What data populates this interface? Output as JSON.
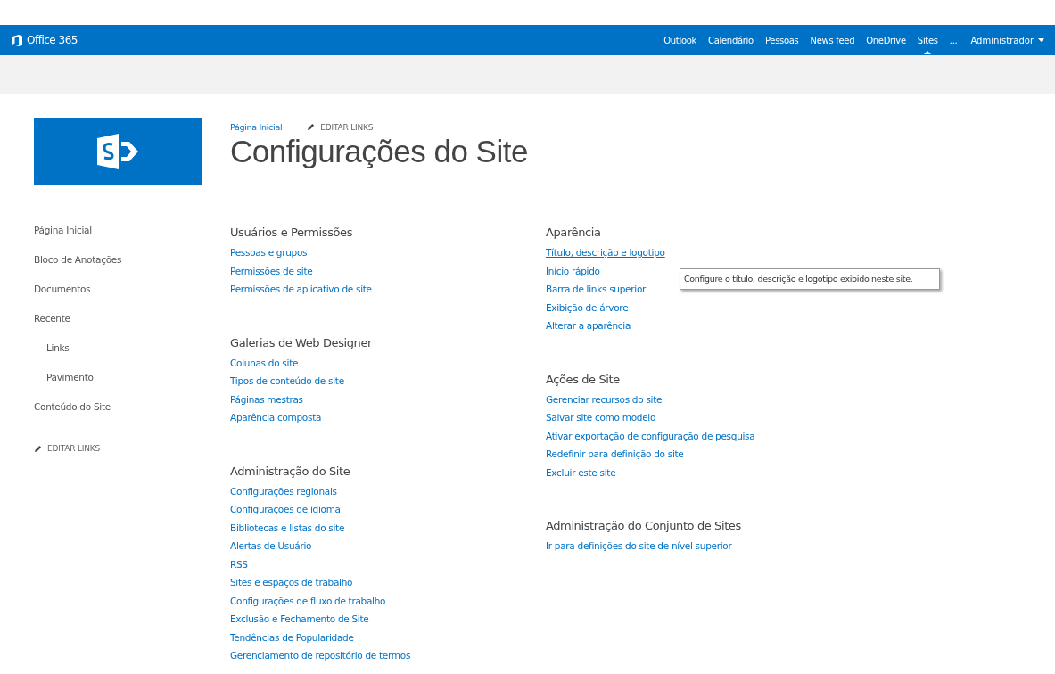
{
  "suite_bar": {
    "brand": "Office 365",
    "links": [
      {
        "label": "Outlook",
        "selected": false
      },
      {
        "label": "Calendário",
        "selected": false
      },
      {
        "label": "Pessoas",
        "selected": false
      },
      {
        "label": "News feed",
        "selected": false
      },
      {
        "label": "OneDrive",
        "selected": false
      },
      {
        "label": "Sites",
        "selected": true
      },
      {
        "label": "...",
        "selected": false
      }
    ],
    "user": "Administrador"
  },
  "breadcrumb": "Página Inicial",
  "edit_links_top": "EDITAR LINKS",
  "title": "Configurações do Site",
  "quick_launch": {
    "items": [
      {
        "label": "Página Inicial"
      },
      {
        "label": "Bloco de Anotações"
      },
      {
        "label": "Documentos"
      },
      {
        "label": "Recente",
        "children": [
          {
            "label": "Links"
          },
          {
            "label": "Pavimento"
          }
        ]
      },
      {
        "label": "Conteúdo do Site"
      }
    ],
    "edit_links": "EDITAR LINKS"
  },
  "columns": [
    [
      {
        "heading": "Usuários e Permissões",
        "links": [
          {
            "label": "Pessoas e grupos",
            "hovered": false
          },
          {
            "label": "Permissões de site",
            "hovered": false
          },
          {
            "label": "Permissões de aplicativo de site",
            "hovered": false
          }
        ]
      },
      {
        "heading": "Galerias de Web Designer",
        "links": [
          {
            "label": "Colunas do site",
            "hovered": false
          },
          {
            "label": "Tipos de conteúdo de site",
            "hovered": false
          },
          {
            "label": "Páginas mestras",
            "hovered": false
          },
          {
            "label": "Aparência composta",
            "hovered": false
          }
        ]
      },
      {
        "heading": "Administração do Site",
        "links": [
          {
            "label": "Configurações regionais",
            "hovered": false
          },
          {
            "label": "Configurações de idioma",
            "hovered": false
          },
          {
            "label": "Bibliotecas e listas do site",
            "hovered": false
          },
          {
            "label": "Alertas de Usuário",
            "hovered": false
          },
          {
            "label": "RSS",
            "hovered": false
          },
          {
            "label": "Sites e espaços de trabalho",
            "hovered": false
          },
          {
            "label": "Configurações de fluxo de trabalho",
            "hovered": false
          },
          {
            "label": "Exclusão e Fechamento de Site",
            "hovered": false
          },
          {
            "label": "Tendências de Popularidade",
            "hovered": false
          },
          {
            "label": "Gerenciamento de repositório de termos",
            "hovered": false
          }
        ]
      }
    ],
    [
      {
        "heading": "Aparência",
        "links": [
          {
            "label": "Título, descrição e logotipo",
            "hovered": true
          },
          {
            "label": "Início rápido",
            "hovered": false
          },
          {
            "label": "Barra de links superior",
            "hovered": false
          },
          {
            "label": "Exibição de árvore",
            "hovered": false
          },
          {
            "label": "Alterar a aparência",
            "hovered": false
          }
        ]
      },
      {
        "heading": "Ações de Site",
        "links": [
          {
            "label": "Gerenciar recursos do site",
            "hovered": false
          },
          {
            "label": "Salvar site como modelo",
            "hovered": false
          },
          {
            "label": "Ativar exportação de configuração de pesquisa",
            "hovered": false
          },
          {
            "label": "Redefinir para definição do site",
            "hovered": false
          },
          {
            "label": "Excluir este site",
            "hovered": false
          }
        ]
      },
      {
        "heading": "Administração do Conjunto de Sites",
        "links": [
          {
            "label": "Ir para definições do site de nível superior",
            "hovered": false
          }
        ]
      }
    ]
  ],
  "tooltip": "Configure o título, descrição e logotipo exibido neste site."
}
